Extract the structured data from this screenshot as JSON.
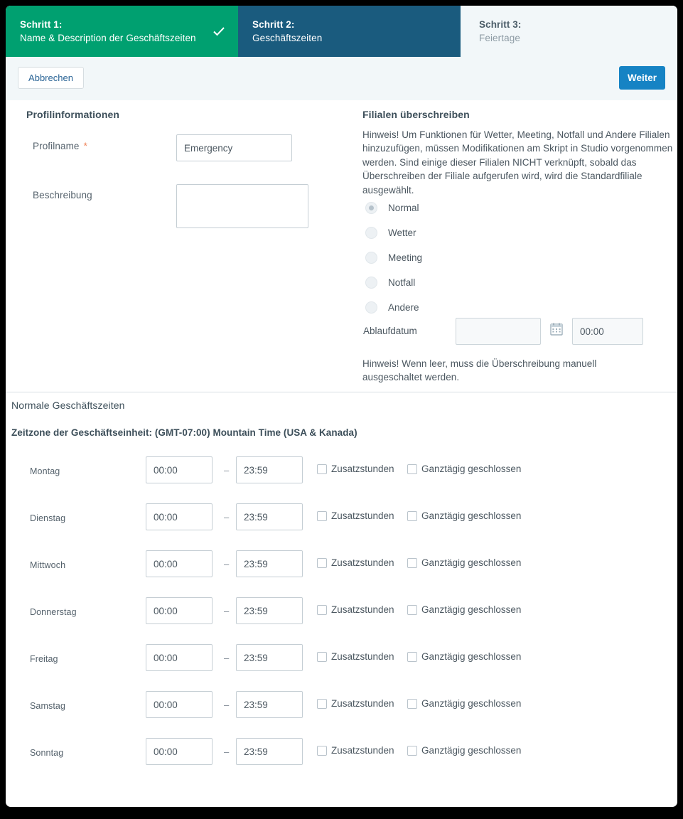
{
  "steps": [
    {
      "number": "Schritt 1:",
      "label": "Name & Description der Geschäftszeiten",
      "state": "done"
    },
    {
      "number": "Schritt 2:",
      "label": "Geschäftszeiten",
      "state": "current"
    },
    {
      "number": "Schritt 3:",
      "label": "Feiertage",
      "state": "upcoming"
    }
  ],
  "toolbar": {
    "cancel_label": "Abbrechen",
    "next_label": "Weiter"
  },
  "profile": {
    "section_title": "Profilinformationen",
    "name_label": "Profilname",
    "required_marker": "*",
    "name_value": "Emergency",
    "description_label": "Beschreibung",
    "description_value": ""
  },
  "override": {
    "section_title": "Filialen überschreiben",
    "note": "Hinweis! Um Funktionen für Wetter, Meeting, Notfall und Andere Filialen hinzuzufügen, müssen Modifikationen am Skript in Studio vorgenommen werden. Sind einige dieser Filialen NICHT verknüpft, sobald das Überschreiben der Filiale aufgerufen wird, wird die Standardfiliale ausgewählt.",
    "options": [
      {
        "label": "Normal",
        "selected": true
      },
      {
        "label": "Wetter",
        "selected": false
      },
      {
        "label": "Meeting",
        "selected": false
      },
      {
        "label": "Notfall",
        "selected": false
      },
      {
        "label": "Andere",
        "selected": false
      }
    ],
    "expiry_label": "Ablaufdatum",
    "expiry_date_value": "",
    "expiry_time_value": "00:00",
    "calendar_icon": "calendar-icon",
    "footer_note": "Hinweis! Wenn leer, muss die Überschreibung manuell ausgeschaltet werden."
  },
  "hours": {
    "section_title": "Normale Geschäftszeiten",
    "timezone": "Zeitzone der Geschäftseinheit: (GMT-07:00) Mountain Time (USA & Kanada)",
    "separator": "–",
    "extra_hours_label": "Zusatzstunden",
    "closed_all_day_label": "Ganztägig geschlossen",
    "days": [
      {
        "name": "Montag",
        "from": "00:00",
        "to": "23:59",
        "extra_hours": false,
        "closed_all_day": false
      },
      {
        "name": "Dienstag",
        "from": "00:00",
        "to": "23:59",
        "extra_hours": false,
        "closed_all_day": false
      },
      {
        "name": "Mittwoch",
        "from": "00:00",
        "to": "23:59",
        "extra_hours": false,
        "closed_all_day": false
      },
      {
        "name": "Donnerstag",
        "from": "00:00",
        "to": "23:59",
        "extra_hours": false,
        "closed_all_day": false
      },
      {
        "name": "Freitag",
        "from": "00:00",
        "to": "23:59",
        "extra_hours": false,
        "closed_all_day": false
      },
      {
        "name": "Samstag",
        "from": "00:00",
        "to": "23:59",
        "extra_hours": false,
        "closed_all_day": false
      },
      {
        "name": "Sonntag",
        "from": "00:00",
        "to": "23:59",
        "extra_hours": false,
        "closed_all_day": false
      }
    ]
  },
  "colors": {
    "step_done": "#00a070",
    "step_current": "#1a5b7e",
    "step_upcoming_bg": "#f2f7f9",
    "primary_button": "#1683c4",
    "required_star": "#f0845a"
  }
}
